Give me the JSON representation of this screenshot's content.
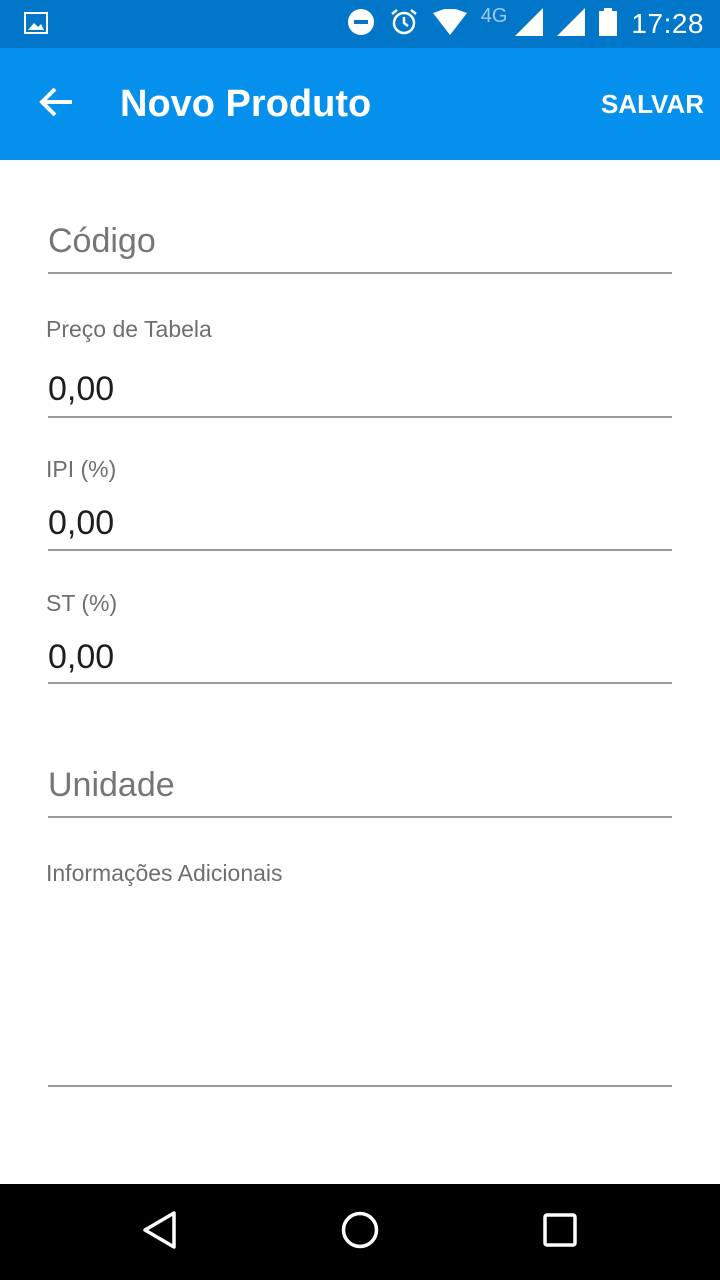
{
  "status_bar": {
    "icons": [
      "image-icon",
      "dnd-icon",
      "alarm-icon",
      "wifi-icon",
      "signal-icon",
      "signal-icon",
      "battery-icon"
    ],
    "network_label": "4G",
    "time": "17:28"
  },
  "app_bar": {
    "back_icon": "arrow-left-icon",
    "title": "Novo Produto",
    "save_label": "SALVAR"
  },
  "form": {
    "codigo": {
      "placeholder": "Código",
      "value": ""
    },
    "preco_tabela": {
      "label": "Preço de Tabela",
      "value": "0,00"
    },
    "ipi": {
      "label": "IPI (%)",
      "value": "0,00"
    },
    "st": {
      "label": "ST (%)",
      "value": "0,00"
    },
    "unidade": {
      "placeholder": "Unidade",
      "value": ""
    },
    "informacoes": {
      "label": "Informações Adicionais",
      "value": ""
    }
  },
  "nav_bar": {
    "icons": [
      "back-triangle-icon",
      "home-circle-icon",
      "recents-square-icon"
    ]
  },
  "colors": {
    "status_bar": "#0277c9",
    "app_bar": "#0590ee",
    "underline": "#9a9a9a",
    "label": "#6f6f6f",
    "value": "#1e1e1e"
  }
}
